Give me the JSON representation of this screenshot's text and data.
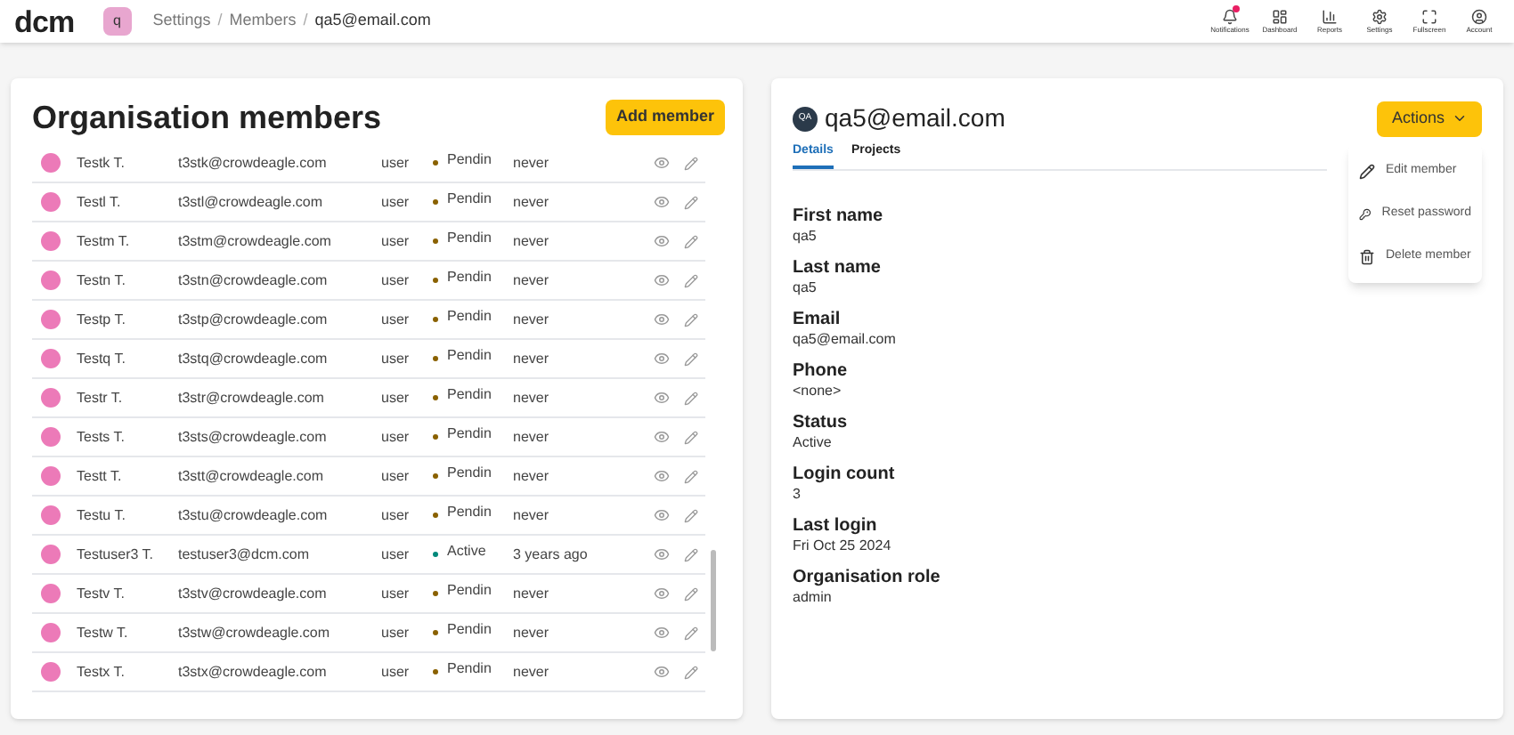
{
  "header": {
    "logo": "dcm",
    "org_badge": "q",
    "breadcrumbs": [
      "Settings",
      "Members",
      "qa5@email.com"
    ],
    "separator": "/",
    "nav": [
      {
        "kind": "bell",
        "label": "Notifications",
        "alert": true
      },
      {
        "kind": "dashboard",
        "label": "Dashboard",
        "alert": false
      },
      {
        "kind": "reports",
        "label": "Reports",
        "alert": false
      },
      {
        "kind": "settings",
        "label": "Settings",
        "alert": false
      },
      {
        "kind": "fullscreen",
        "label": "Fullscreen",
        "alert": false
      },
      {
        "kind": "account",
        "label": "Account",
        "alert": false
      }
    ]
  },
  "members": {
    "title": "Organisation members",
    "add_button": "Add member",
    "rows": [
      {
        "name": "Testk T.",
        "email": "t3stk@crowdeagle.com",
        "role": "user",
        "status": "Pendin",
        "active": false,
        "last_login": "never"
      },
      {
        "name": "Testl T.",
        "email": "t3stl@crowdeagle.com",
        "role": "user",
        "status": "Pendin",
        "active": false,
        "last_login": "never"
      },
      {
        "name": "Testm T.",
        "email": "t3stm@crowdeagle.com",
        "role": "user",
        "status": "Pendin",
        "active": false,
        "last_login": "never"
      },
      {
        "name": "Testn T.",
        "email": "t3stn@crowdeagle.com",
        "role": "user",
        "status": "Pendin",
        "active": false,
        "last_login": "never"
      },
      {
        "name": "Testp T.",
        "email": "t3stp@crowdeagle.com",
        "role": "user",
        "status": "Pendin",
        "active": false,
        "last_login": "never"
      },
      {
        "name": "Testq T.",
        "email": "t3stq@crowdeagle.com",
        "role": "user",
        "status": "Pendin",
        "active": false,
        "last_login": "never"
      },
      {
        "name": "Testr T.",
        "email": "t3str@crowdeagle.com",
        "role": "user",
        "status": "Pendin",
        "active": false,
        "last_login": "never"
      },
      {
        "name": "Tests T.",
        "email": "t3sts@crowdeagle.com",
        "role": "user",
        "status": "Pendin",
        "active": false,
        "last_login": "never"
      },
      {
        "name": "Testt T.",
        "email": "t3stt@crowdeagle.com",
        "role": "user",
        "status": "Pendin",
        "active": false,
        "last_login": "never"
      },
      {
        "name": "Testu T.",
        "email": "t3stu@crowdeagle.com",
        "role": "user",
        "status": "Pendin",
        "active": false,
        "last_login": "never"
      },
      {
        "name": "Testuser3 T.",
        "email": "testuser3@dcm.com",
        "role": "user",
        "status": "Active",
        "active": true,
        "last_login": "3 years ago"
      },
      {
        "name": "Testv T.",
        "email": "t3stv@crowdeagle.com",
        "role": "user",
        "status": "Pendin",
        "active": false,
        "last_login": "never"
      },
      {
        "name": "Testw T.",
        "email": "t3stw@crowdeagle.com",
        "role": "user",
        "status": "Pendin",
        "active": false,
        "last_login": "never"
      },
      {
        "name": "Testx T.",
        "email": "t3stx@crowdeagle.com",
        "role": "user",
        "status": "Pendin",
        "active": false,
        "last_login": "never"
      }
    ]
  },
  "detail": {
    "avatar": "QA",
    "title": "qa5@email.com",
    "actions_button": "Actions",
    "tabs": [
      {
        "label": "Details",
        "selected": true
      },
      {
        "label": "Projects",
        "selected": false
      }
    ],
    "fields": [
      {
        "label": "First name",
        "value": "qa5"
      },
      {
        "label": "Last name",
        "value": "qa5"
      },
      {
        "label": "Email",
        "value": "qa5@email.com"
      },
      {
        "label": "Phone",
        "value": "<none>"
      },
      {
        "label": "Status",
        "value": "Active"
      },
      {
        "label": "Login count",
        "value": "3"
      },
      {
        "label": "Last login",
        "value": "Fri Oct 25 2024"
      },
      {
        "label": "Organisation role",
        "value": "admin"
      }
    ],
    "menu": [
      {
        "kind": "edit",
        "label": "Edit member"
      },
      {
        "kind": "key",
        "label": "Reset password"
      },
      {
        "kind": "delete",
        "label": "Delete member"
      }
    ]
  }
}
